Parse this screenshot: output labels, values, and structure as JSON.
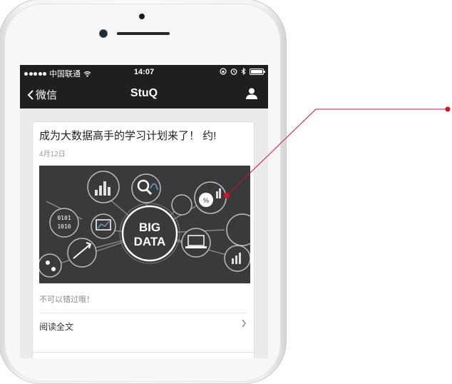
{
  "status_bar": {
    "carrier": "中国联通",
    "time": "14:07"
  },
  "nav": {
    "back_label": "微信",
    "title": "StuQ"
  },
  "article": {
    "title": "成为大数据高手的学习计划来了！ 约!",
    "date": "4月12日",
    "image_text_1": "BIG",
    "image_text_2": "DATA",
    "description": "不可以错过哦！",
    "read_more": "阅读全文"
  },
  "icons": {
    "back": "chevron-left-icon",
    "user": "user-icon",
    "chevron": "chevron-right-icon"
  },
  "colors": {
    "bar": "#1f1f21",
    "accent": "#d4112b",
    "image_bg": "#3a3a3c"
  }
}
